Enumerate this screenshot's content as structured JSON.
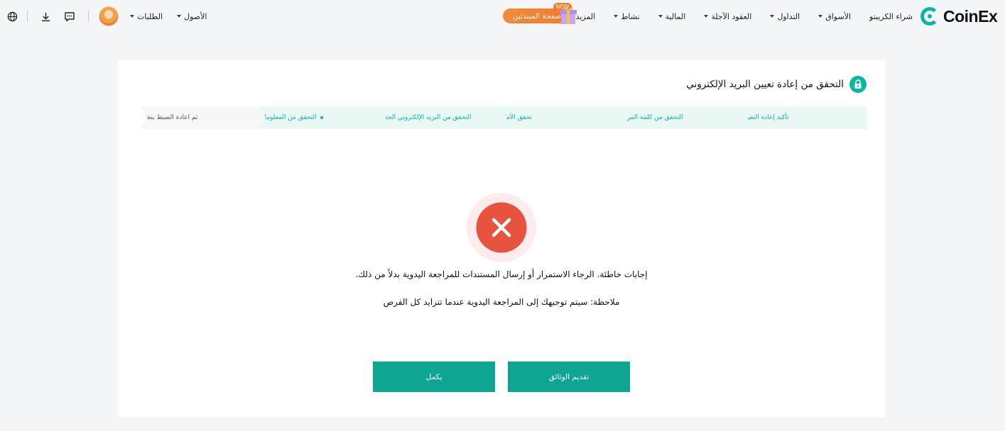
{
  "brand": {
    "name": "CoinEx"
  },
  "nav": {
    "items": [
      {
        "label": "شراء الكريبتو",
        "dropdown": false
      },
      {
        "label": "الأسواق",
        "dropdown": true
      },
      {
        "label": "التداول",
        "dropdown": true
      },
      {
        "label": "العقود الآجلة",
        "dropdown": true
      },
      {
        "label": "المالية",
        "dropdown": true
      },
      {
        "label": "نشاط",
        "dropdown": true,
        "badge": "NEW"
      },
      {
        "label": "المزيد",
        "dropdown": true
      }
    ],
    "beginner_label": "صفحة المبتدئين",
    "left": {
      "orders_label": "الطلبات",
      "assets_label": "الأصول"
    },
    "icons": [
      "globe-icon",
      "download-icon",
      "message-icon",
      "avatar"
    ]
  },
  "card": {
    "title": "التحقق من إعادة تعيين البريد الإلكتروني",
    "steps": [
      {
        "label": "تأكيد إعادة التعيين",
        "state": "done"
      },
      {
        "label": "التحقق من كلمة المرور",
        "state": "done"
      },
      {
        "label": "تحقق الأمان",
        "state": "done"
      },
      {
        "label": "التحقق من البريد الإلكتروني الجديد",
        "state": "done"
      },
      {
        "label": "التحقق من المعلومات",
        "state": "current"
      },
      {
        "label": "تم اعادة الضبط بنجاح",
        "state": "pending"
      }
    ],
    "status_icon": "error-x-icon",
    "message": "إجابات خاطئة. الرجاء الاستمرار أو إرسال المستندات للمراجعة اليدوية بدلاً من ذلك.",
    "note": "ملاحظة: سيتم توجيهك إلى المراجعة اليدوية عندما تتزايد كل الفرص",
    "buttons": {
      "submit_label": "تقديم الوثائق",
      "continue_label": "يكمل"
    }
  },
  "colors": {
    "accent": "#0ea593",
    "error": "#e8533f",
    "error_halo": "#fdeceb",
    "orange": "#f47a2b"
  }
}
